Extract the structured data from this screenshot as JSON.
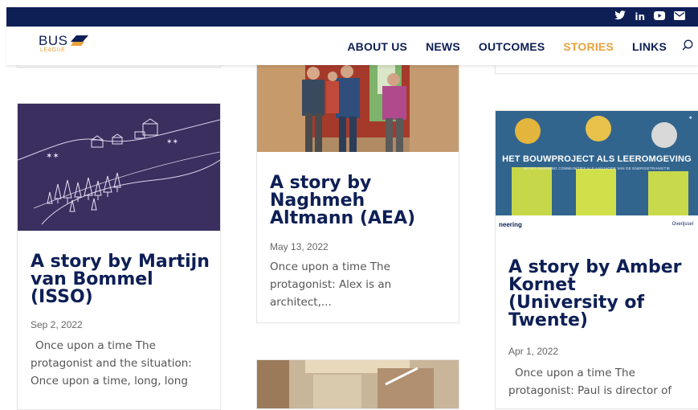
{
  "social": {
    "twitter": "🐦",
    "linkedin": "in",
    "youtube": "▶",
    "email": "✉"
  },
  "logo": {
    "word": "BUS",
    "sub": "LEAGUE"
  },
  "nav": {
    "items": [
      {
        "label": "ABOUT US"
      },
      {
        "label": "NEWS"
      },
      {
        "label": "OUTCOMES"
      },
      {
        "label": "STORIES"
      },
      {
        "label": "LINKS"
      }
    ],
    "active_color": "#e9a23b",
    "brand_color": "#0d1f55"
  },
  "stories": [
    {
      "title": "A story by Martijn van Bommel (ISSO)",
      "date": "Sep 2, 2022",
      "excerpt": "Once upon a time The protagonist and the situation: Once upon a time, long, long"
    },
    {
      "title": "A story by Naghmeh Altmann (AEA)",
      "date": "May 13, 2022",
      "excerpt": "Once upon a time The protagonist: Alex is an architect,..."
    },
    {
      "title": "A story by Amber Kornet (University of Twente)",
      "date": "Apr 1, 2022",
      "excerpt": "Once upon a time The protagonist: Paul is director of",
      "image_caption": "HET BOUWPROJECT ALS LEEROMGEVING",
      "image_subcaption": "MICRO LEARNING COMMUNITIES ALS AANJAGER VAN DE ENERGIETRANSITIE",
      "image_logo_left": "neering",
      "image_logo_right": "Overijssel"
    }
  ]
}
